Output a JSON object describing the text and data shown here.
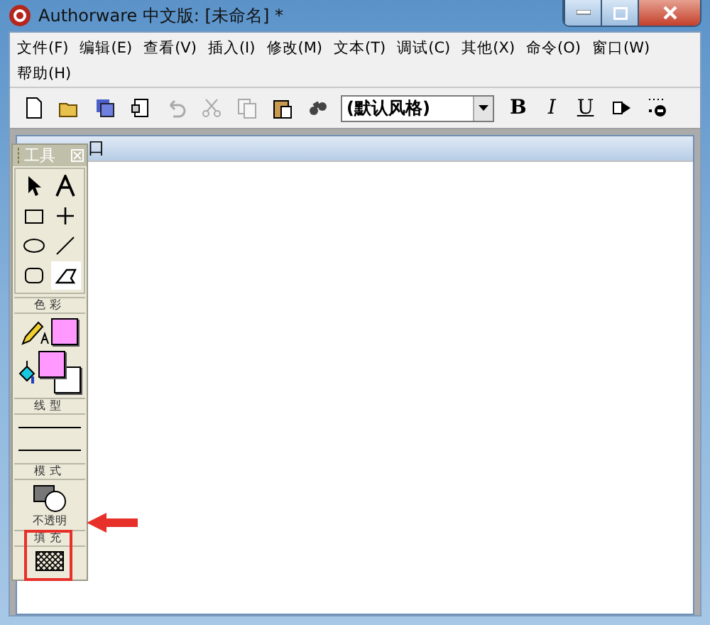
{
  "window": {
    "title": "Authorware 中文版: [未命名] *"
  },
  "menu": [
    {
      "label": "文件(F)"
    },
    {
      "label": "编辑(E)"
    },
    {
      "label": "查看(V)"
    },
    {
      "label": "插入(I)"
    },
    {
      "label": "修改(M)"
    },
    {
      "label": "文本(T)"
    },
    {
      "label": "调试(C)"
    },
    {
      "label": "其他(X)"
    },
    {
      "label": "命令(O)"
    },
    {
      "label": "窗口(W)"
    },
    {
      "label": "帮助(H)"
    }
  ],
  "toolbar": {
    "buttons": [
      {
        "kind": "new",
        "disabled": false
      },
      {
        "kind": "open",
        "disabled": false
      },
      {
        "kind": "save-all",
        "disabled": false
      },
      {
        "kind": "import",
        "disabled": false
      },
      {
        "kind": "undo",
        "disabled": true
      },
      {
        "kind": "cut",
        "disabled": true
      },
      {
        "kind": "copy",
        "disabled": true
      },
      {
        "kind": "paste",
        "disabled": false
      },
      {
        "kind": "find",
        "disabled": false
      },
      {
        "kind": "style-select",
        "value": "(默认风格)"
      },
      {
        "kind": "bold",
        "label": "B"
      },
      {
        "kind": "italic",
        "label": "I"
      },
      {
        "kind": "underline",
        "label": "U"
      },
      {
        "kind": "run",
        "disabled": false
      },
      {
        "kind": "control",
        "disabled": false
      }
    ]
  },
  "presentation_window": {
    "title_visible": "口"
  },
  "tools_palette": {
    "title": "工具",
    "tools": [
      {
        "kind": "pointer",
        "selected": false
      },
      {
        "kind": "text",
        "selected": false
      },
      {
        "kind": "rectangle",
        "selected": false
      },
      {
        "kind": "cross",
        "selected": false
      },
      {
        "kind": "ellipse",
        "selected": false
      },
      {
        "kind": "line",
        "selected": false
      },
      {
        "kind": "rounded-rectangle",
        "selected": false
      },
      {
        "kind": "polygon",
        "selected": true
      }
    ],
    "color_label": "色彩",
    "swatches": [
      {
        "kind": "line",
        "color": "#ff99ff"
      },
      {
        "kind": "fill-foreground",
        "color": "#ff99ff"
      },
      {
        "kind": "fill-background",
        "color": "#ffffff"
      }
    ],
    "line_label": "线型",
    "mode_label": "模式",
    "mode_value": "不透明",
    "fill_label": "填充"
  }
}
